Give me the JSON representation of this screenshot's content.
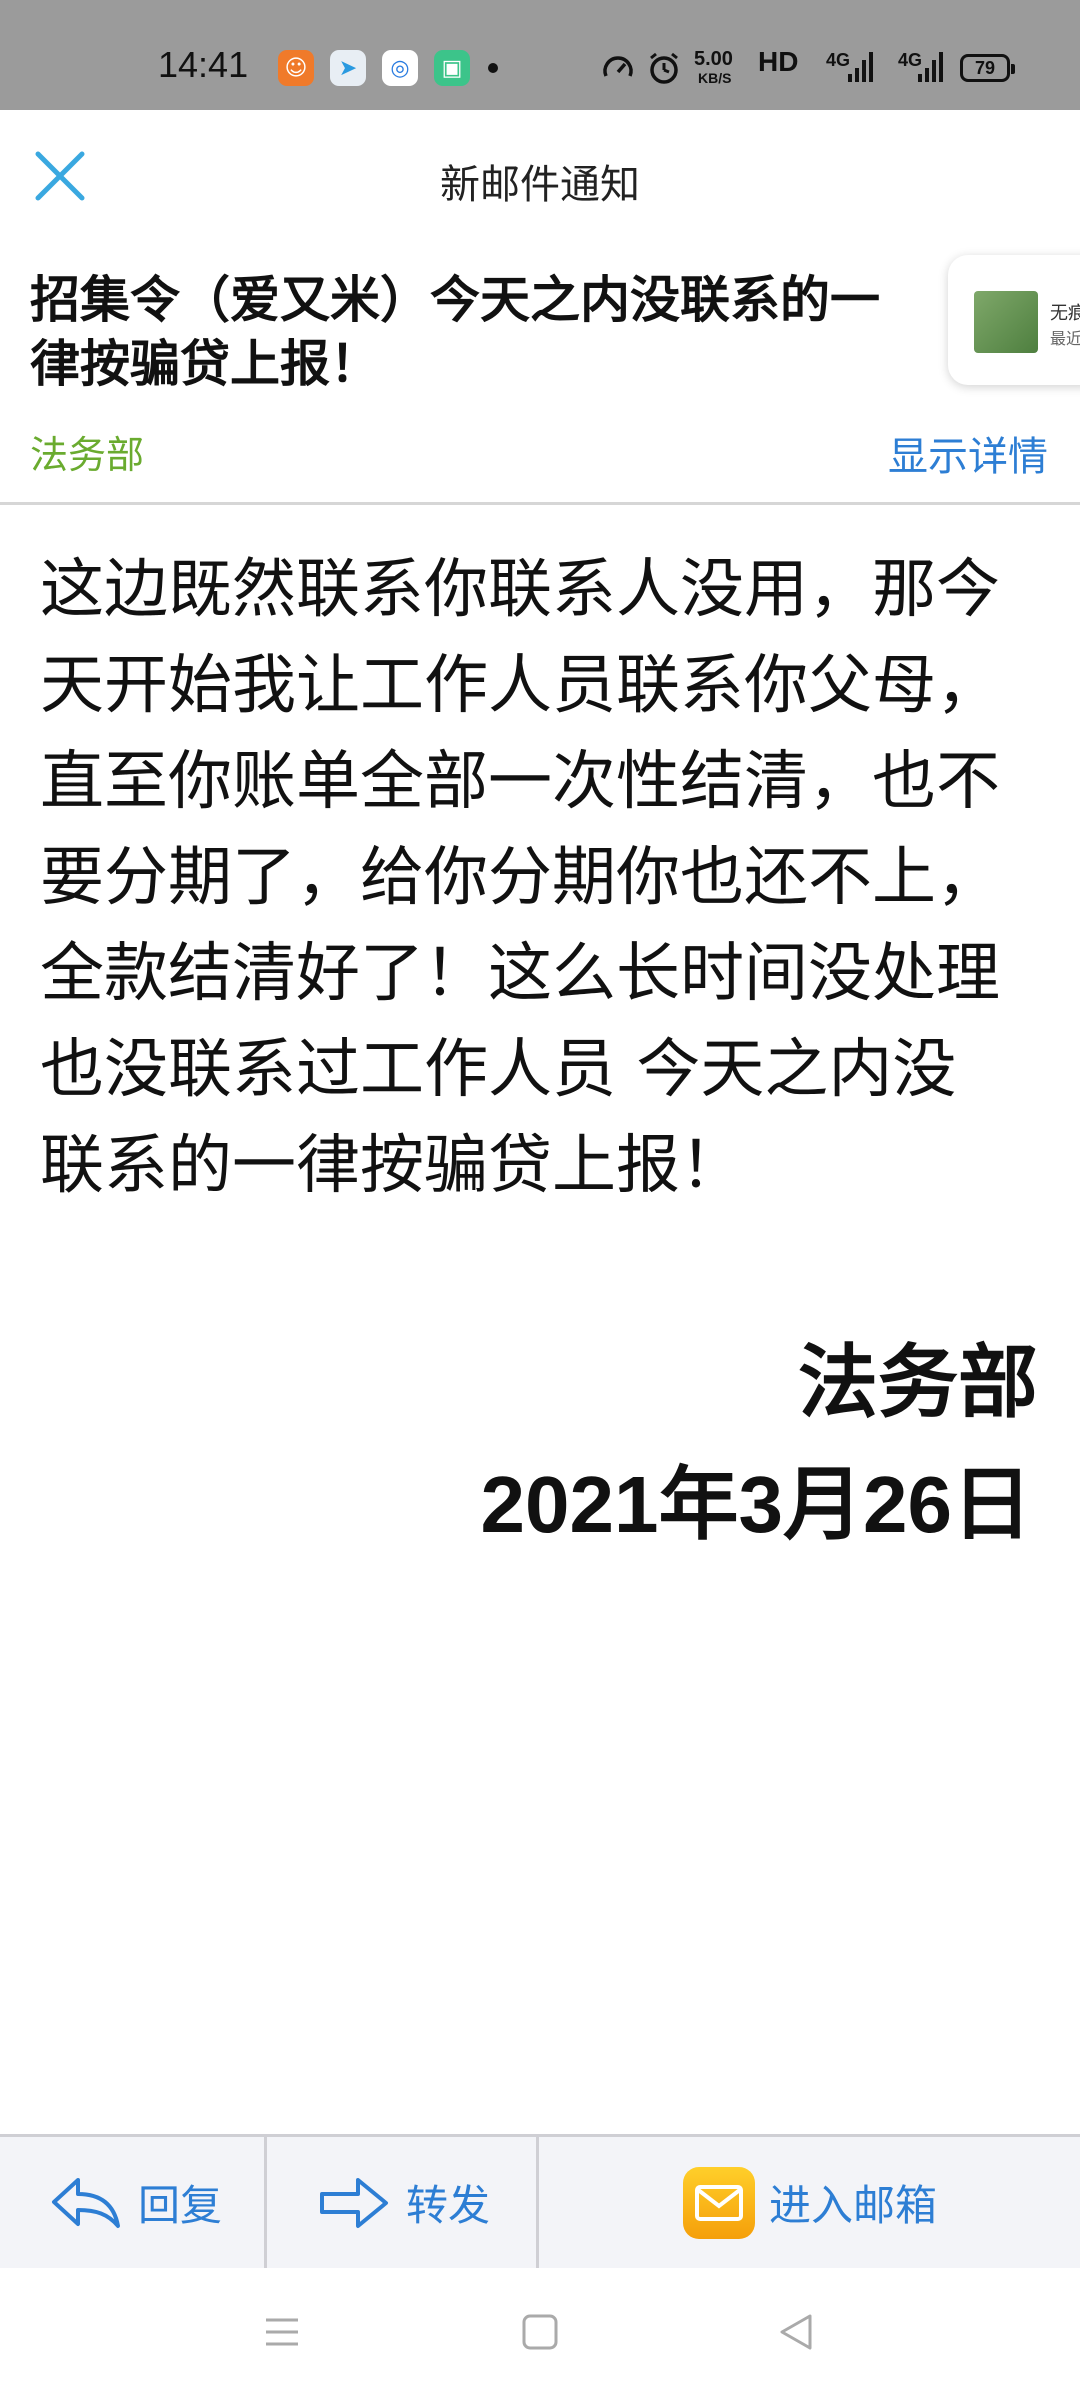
{
  "status_bar": {
    "time": "14:41",
    "speed_value": "5.00",
    "speed_unit": "KB/S",
    "network_1": "HD",
    "network_2": "4G",
    "network_3": "4G",
    "battery": "79",
    "icons": [
      "uc-browser-icon",
      "telegram-icon",
      "qq-browser-icon",
      "green-app-icon",
      "dashboard-icon",
      "alarm-icon",
      "signal-icon",
      "battery-icon"
    ]
  },
  "header": {
    "title": "新邮件通知"
  },
  "email": {
    "subject": "招集令（爱又米）今天之内没联系的一律按骗贷上报！",
    "sender": "法务部",
    "details_link": "显示详情",
    "body": "这边既然联系你联系人没用，那今天开始我让工作人员联系你父母，直至你账单全部一次性结清，也不要分期了，给你分期你也还不上，全款结清好了！这么长时间没处理也没联系过工作人员 今天之内没联系的一律按骗贷上报！",
    "signature_dept": "法务部",
    "signature_date": "2021年3月26日"
  },
  "ad_card": {
    "line1": "无痕",
    "line2": "最近"
  },
  "bottom_bar": {
    "reply_label": "回复",
    "forward_label": "转发",
    "inbox_label": "进入邮箱"
  },
  "colors": {
    "accent_blue": "#2d7ed4",
    "sender_green": "#6aab2f",
    "close_blue": "#3aa8e0",
    "status_bg": "#9b9b9b"
  }
}
